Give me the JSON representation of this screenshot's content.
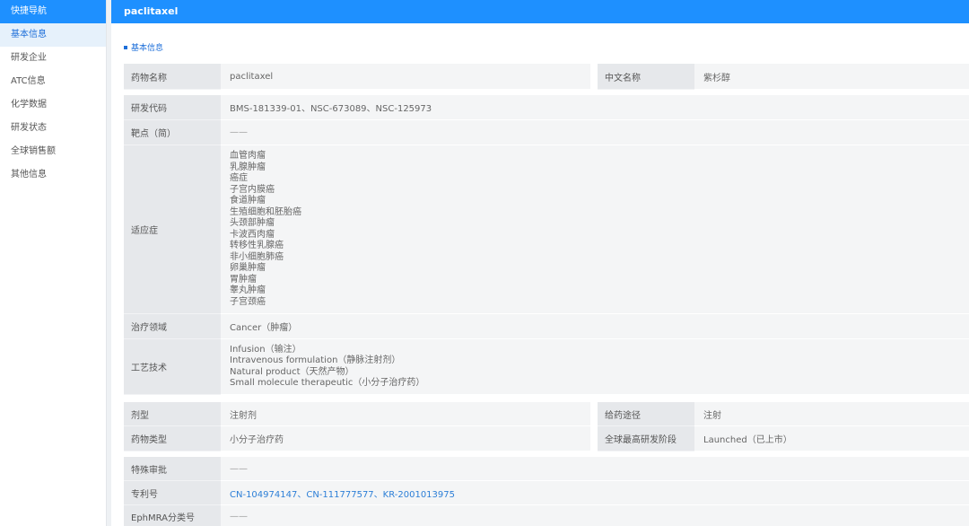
{
  "sidebar": {
    "header": "快捷导航",
    "items": [
      "基本信息",
      "研发企业",
      "ATC信息",
      "化学数据",
      "研发状态",
      "全球销售额",
      "其他信息"
    ]
  },
  "topbar": {
    "title": "paclitaxel"
  },
  "section": {
    "title": "基本信息"
  },
  "fields": {
    "drug_name_label": "药物名称",
    "drug_name": "paclitaxel",
    "cn_name_label": "中文名称",
    "cn_name": "紫杉醇",
    "dev_code_label": "研发代码",
    "dev_code": "BMS-181339-01、NSC-673089、NSC-125973",
    "target_label": "靶点（简）",
    "target": "——",
    "indication_label": "适应症",
    "indications": [
      "血管肉瘤",
      "乳腺肿瘤",
      "癌症",
      "子宫内膜癌",
      "食道肿瘤",
      "生殖细胞和胚胎癌",
      "头颈部肿瘤",
      "卡波西肉瘤",
      "转移性乳腺癌",
      "非小细胞肺癌",
      "卵巢肿瘤",
      "胃肿瘤",
      "睾丸肿瘤",
      "子宫颈癌"
    ],
    "therapy_label": "治疗领域",
    "therapy": "Cancer（肿瘤）",
    "tech_label": "工艺技术",
    "techs": [
      "Infusion（输注）",
      "Intravenous formulation（静脉注射剂）",
      "Natural product（天然产物）",
      "Small molecule therapeutic（小分子治疗药）"
    ],
    "dosage_label": "剂型",
    "dosage": "注射剂",
    "route_label": "给药途径",
    "route": "注射",
    "drug_type_label": "药物类型",
    "drug_type": "小分子治疗药",
    "phase_label": "全球最高研发阶段",
    "phase": "Launched（已上市）",
    "special_label": "特殊审批",
    "special": "——",
    "patent_label": "专利号",
    "patent": "CN-104974147、CN-111777577、KR-2001013975",
    "ephmra_label": "EphMRA分类号",
    "ephmra": "——"
  }
}
